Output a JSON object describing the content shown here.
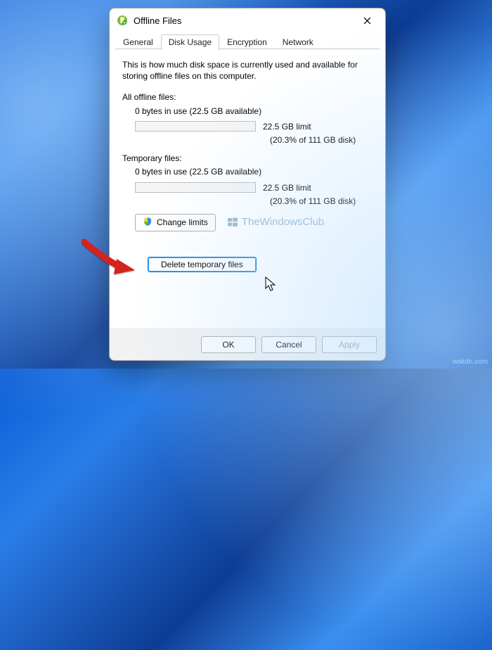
{
  "window": {
    "title": "Offline Files"
  },
  "tabs": {
    "general": "General",
    "disk_usage": "Disk Usage",
    "encryption": "Encryption",
    "network": "Network"
  },
  "panel": {
    "intro": "This is how much disk space is currently used and available for storing offline files on this computer.",
    "all_label": "All offline files:",
    "all_usage": "0 bytes in use (22.5 GB available)",
    "all_limit": "22.5 GB limit",
    "all_pct": "(20.3% of 111 GB disk)",
    "temp_label": "Temporary files:",
    "temp_usage": "0 bytes in use (22.5 GB available)",
    "temp_limit": "22.5 GB limit",
    "temp_pct": "(20.3% of 111 GB disk)",
    "change_limits": "Change limits",
    "delete_temp": "Delete temporary files",
    "watermark": "TheWindowsClub"
  },
  "footer": {
    "ok": "OK",
    "cancel": "Cancel",
    "apply": "Apply"
  },
  "corner": "wskdn.com"
}
